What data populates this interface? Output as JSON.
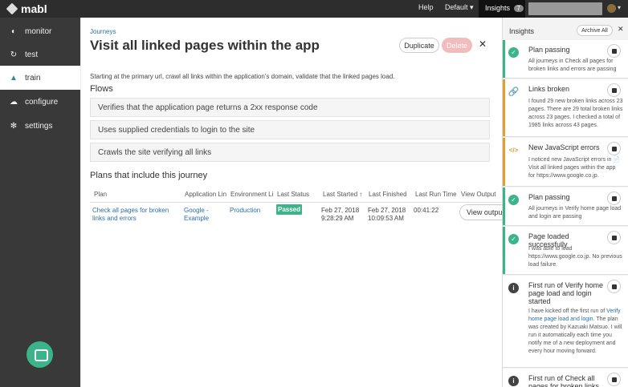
{
  "app": {
    "name": "mabl"
  },
  "topbar": {
    "help_label": "Help",
    "env_label": "Default ▾",
    "insights_label": "Insights",
    "insights_count": "7",
    "user_caret": "▾"
  },
  "sidebar": {
    "items": [
      {
        "label": "monitor",
        "icon": "dashboard-icon"
      },
      {
        "label": "test",
        "icon": "refresh-icon"
      },
      {
        "label": "train",
        "icon": "graduation-cap-icon"
      },
      {
        "label": "configure",
        "icon": "cloud-icon"
      },
      {
        "label": "settings",
        "icon": "gear-icon"
      }
    ],
    "active": "train"
  },
  "journey": {
    "breadcrumb": "Journeys",
    "title": "Visit all linked pages within the app",
    "duplicate_label": "Duplicate",
    "delete_label": "Delete",
    "description": "Starting at the primary url, crawl all links within the application's domain, validate that the linked pages load.",
    "flows_title": "Flows",
    "flows": [
      "Verifies that the application page returns a 2xx response code",
      "Uses supplied credentials to login to the site",
      "Crawls the site verifying all links"
    ],
    "plans_title": "Plans that include this journey",
    "plans_table": {
      "headers": [
        "Plan",
        "Application Lin",
        "Environment Li",
        "Last Status",
        "Last Started ↑",
        "Last Finished",
        "Last Run Time",
        "View Output"
      ],
      "rows": [
        {
          "plan": "Check all pages for broken links and errors",
          "application": "Google - Example",
          "environment": "Production",
          "status": "Passed",
          "started": "Feb 27, 2018 9:28:29 AM",
          "finished": "Feb 27, 2018 10:09:53 AM",
          "run_time": "00:41:22",
          "view_label": "View output"
        }
      ]
    }
  },
  "insights": {
    "title": "Insights",
    "archive_label": "Archive All",
    "cards": [
      {
        "type": "success",
        "title": "Plan passing",
        "body": "All journeys in Check all pages for broken links and errors are passing"
      },
      {
        "type": "warning",
        "title": "Links broken",
        "body": "I found 29 new broken links across 23 pages. There are 29 total broken links across 23 pages. I checked a total of 1985 links across 43 pages."
      },
      {
        "type": "warning",
        "title": "New JavaScript errors",
        "body": "I noticed new JavaScript errors in 📄 Visit all linked pages within the app for https://www.google.co.jp."
      },
      {
        "type": "success",
        "title": "Plan passing",
        "body": "All journeys in Verify home page load and login are passing"
      },
      {
        "type": "success",
        "title": "Page loaded successfully",
        "body": "I was able to load https://www.google.co.jp. No previous load failure."
      },
      {
        "type": "info",
        "title": "First run of Verify home page load and login started",
        "body_pre": "I have kicked off the first run of",
        "body_link": "Verify home page load and login.",
        "body_post": "The plan was created by Kazuaki Matsuo. I will run it automatically each time you notify me of a new deployment and every hour moving forward."
      },
      {
        "type": "info",
        "title": "First run of Check all pages for broken links",
        "body": ""
      }
    ]
  },
  "colors": {
    "accent": "#2d8f8f",
    "success": "#3cb48a",
    "warning": "#e0a030",
    "danger": "#f3bcbc",
    "link": "#2b6fa6"
  }
}
